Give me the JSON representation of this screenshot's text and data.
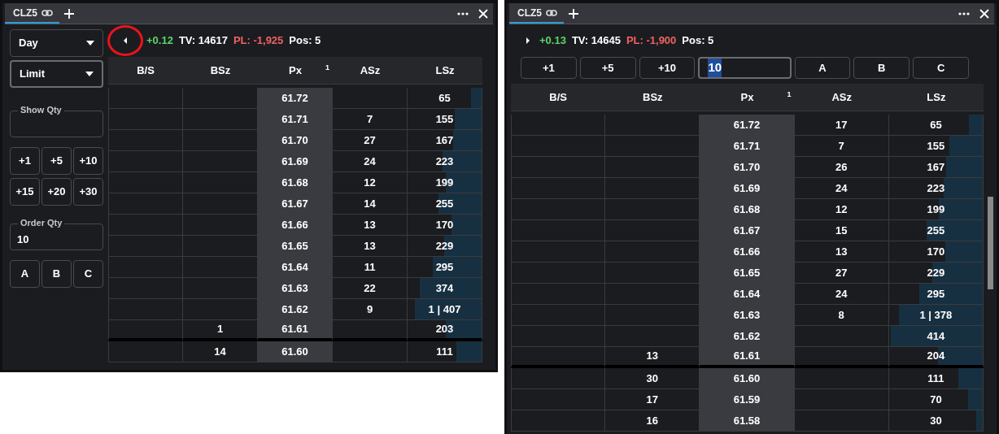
{
  "panels": [
    {
      "tabs": [
        {
          "label": "CLZ5",
          "selected": true
        }
      ],
      "info": {
        "expanded": true,
        "circled": true,
        "change": "+0.12",
        "tv": "TV: 14617",
        "pl": "PL: -1,925",
        "pos": "Pos: 5"
      },
      "sidebar": {
        "selects": [
          {
            "label": "Day",
            "focused": false
          },
          {
            "label": "Limit",
            "focused": true
          }
        ],
        "show_qty": {
          "label": "Show Qty"
        },
        "increments": [
          "+1",
          "+5",
          "+10",
          "+15",
          "+20",
          "+30"
        ],
        "order_qty": {
          "label": "Order Qty",
          "value": "10"
        },
        "accounts": [
          "A",
          "B",
          "C"
        ]
      },
      "ladder": {
        "columns": [
          "B/S",
          "BSz",
          "Px",
          "ASz",
          "LSz"
        ],
        "px_badge": "1",
        "rows": [
          {
            "px": "61.72",
            "lsz": "65",
            "level": 0.14,
            "separator_below": false
          },
          {
            "px": "61.71",
            "asz": "7",
            "lsz": "155",
            "level": 0.36,
            "separator_below": false
          },
          {
            "px": "61.70",
            "asz": "27",
            "lsz": "167",
            "level": 0.39,
            "separator_below": false
          },
          {
            "px": "61.69",
            "asz": "24",
            "lsz": "223",
            "level": 0.53,
            "separator_below": false
          },
          {
            "px": "61.68",
            "asz": "12",
            "lsz": "199",
            "level": 0.48,
            "separator_below": false
          },
          {
            "px": "61.67",
            "asz": "14",
            "lsz": "255",
            "level": 0.58,
            "separator_below": false
          },
          {
            "px": "61.66",
            "asz": "13",
            "lsz": "170",
            "level": 0.41,
            "separator_below": false
          },
          {
            "px": "61.65",
            "asz": "13",
            "lsz": "229",
            "level": 0.51,
            "separator_below": false
          },
          {
            "px": "61.64",
            "asz": "11",
            "lsz": "295",
            "level": 0.66,
            "separator_below": false
          },
          {
            "px": "61.63",
            "asz": "22",
            "lsz": "374",
            "level": 0.84,
            "separator_below": false
          },
          {
            "px": "61.62",
            "asz": "9",
            "lsz": "1 | 407",
            "level": 0.9,
            "separator_below": false
          },
          {
            "bsz": "1",
            "px": "61.61",
            "lsz": "203",
            "level": 0.48,
            "separator_below": true
          },
          {
            "bsz": "14",
            "px": "61.60",
            "lsz": "111",
            "level": 0.34,
            "separator_below": false
          }
        ]
      }
    },
    {
      "tabs": [
        {
          "label": "CLZ5",
          "selected": true
        }
      ],
      "info": {
        "expanded": false,
        "circled": false,
        "change": "+0.13",
        "tv": "TV: 14645",
        "pl": "PL: -1,900",
        "pos": "Pos: 5"
      },
      "quick_bar": {
        "increments": [
          "+1",
          "+5",
          "+10"
        ],
        "qty": {
          "value": "10",
          "text_selected": true
        },
        "accounts": [
          "A",
          "B",
          "C"
        ]
      },
      "ladder": {
        "columns": [
          "B/S",
          "BSz",
          "Px",
          "ASz",
          "LSz"
        ],
        "px_badge": "1",
        "rows": [
          {
            "px": "61.72",
            "asz": "17",
            "lsz": "65",
            "level": 0.15,
            "separator_below": false
          },
          {
            "px": "61.71",
            "asz": "7",
            "lsz": "155",
            "level": 0.36,
            "separator_below": false
          },
          {
            "px": "61.70",
            "asz": "26",
            "lsz": "167",
            "level": 0.39,
            "separator_below": false
          },
          {
            "px": "61.69",
            "asz": "24",
            "lsz": "223",
            "level": 0.42,
            "separator_below": false
          },
          {
            "px": "61.68",
            "asz": "12",
            "lsz": "199",
            "level": 0.47,
            "separator_below": false
          },
          {
            "px": "61.67",
            "asz": "15",
            "lsz": "255",
            "level": 0.6,
            "separator_below": false
          },
          {
            "px": "61.66",
            "asz": "13",
            "lsz": "170",
            "level": 0.4,
            "separator_below": false
          },
          {
            "px": "61.65",
            "asz": "27",
            "lsz": "229",
            "level": 0.54,
            "separator_below": false
          },
          {
            "px": "61.64",
            "asz": "24",
            "lsz": "295",
            "level": 0.68,
            "separator_below": false
          },
          {
            "px": "61.63",
            "asz": "8",
            "lsz": "1 | 378",
            "level": 0.89,
            "separator_below": false
          },
          {
            "px": "61.62",
            "lsz": "414",
            "level": 0.98,
            "separator_below": false
          },
          {
            "bsz": "13",
            "px": "61.61",
            "lsz": "204",
            "level": 0.48,
            "separator_below": true
          },
          {
            "bsz": "30",
            "px": "61.60",
            "lsz": "111",
            "level": 0.26,
            "separator_below": false
          },
          {
            "bsz": "17",
            "px": "61.59",
            "lsz": "70",
            "level": 0.16,
            "separator_below": false
          },
          {
            "bsz": "16",
            "px": "61.58",
            "lsz": "30",
            "level": 0.07,
            "separator_below": false
          }
        ]
      }
    }
  ]
}
